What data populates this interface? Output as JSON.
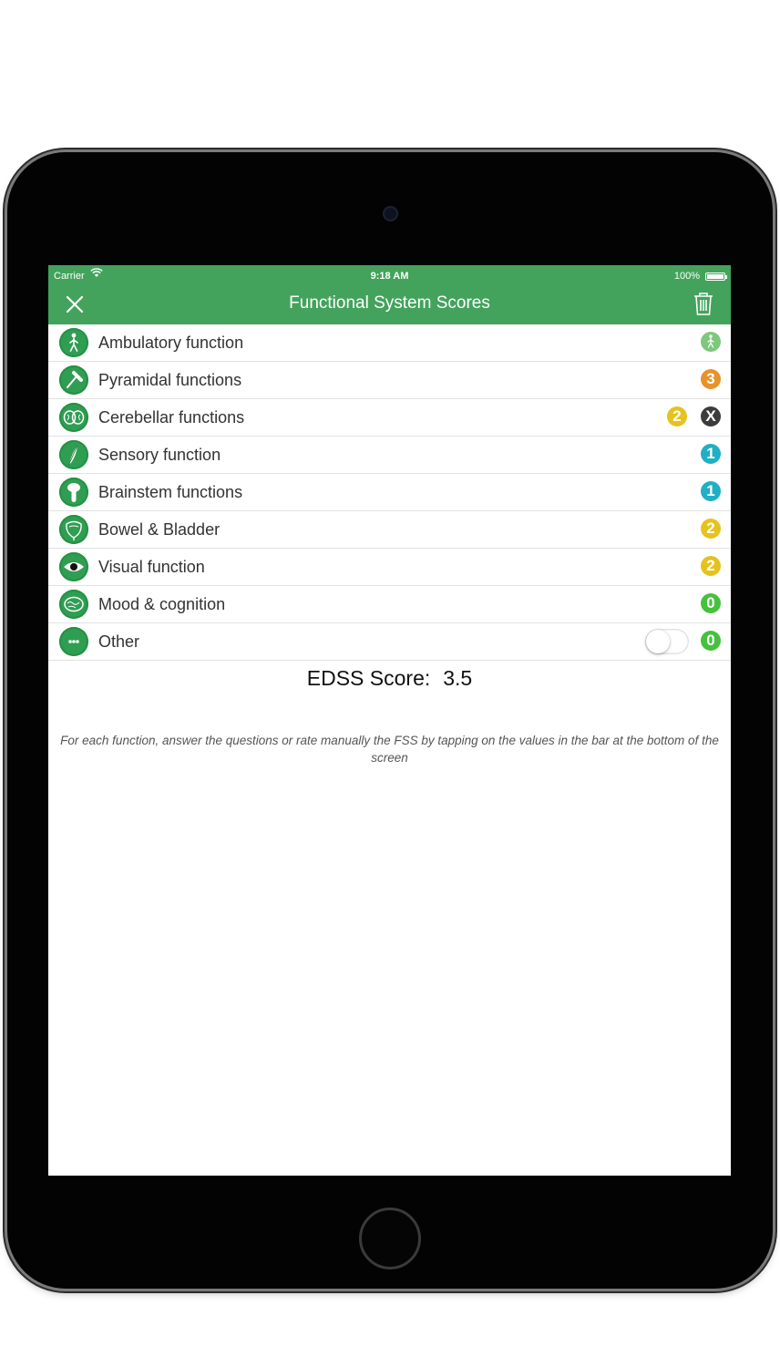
{
  "status_bar": {
    "carrier": "Carrier",
    "time": "9:18 AM",
    "battery": "100%"
  },
  "nav": {
    "title": "Functional System Scores",
    "close_icon": "close-icon",
    "trash_icon": "trash-icon"
  },
  "colors": {
    "header_green": "#43a35c",
    "row_icon_green": "#2f9e52",
    "score_orange": "#e8922a",
    "score_yellow": "#e6c21e",
    "score_cyan": "#21afc6",
    "score_green": "#46c13e",
    "score_dark": "#3c3c3c"
  },
  "rows": [
    {
      "label": "Ambulatory function",
      "icon": "walking-person-icon",
      "score_icon": "walking-person-icon"
    },
    {
      "label": "Pyramidal functions",
      "icon": "reflex-hammer-icon",
      "scores": [
        "3"
      ]
    },
    {
      "label": "Cerebellar functions",
      "icon": "cerebellum-icon",
      "scores": [
        "2",
        "X"
      ]
    },
    {
      "label": "Sensory function",
      "icon": "feather-icon",
      "scores": [
        "1"
      ]
    },
    {
      "label": "Brainstem functions",
      "icon": "brainstem-icon",
      "scores": [
        "1"
      ]
    },
    {
      "label": "Bowel & Bladder",
      "icon": "bladder-icon",
      "scores": [
        "2"
      ]
    },
    {
      "label": "Visual function",
      "icon": "eye-icon",
      "scores": [
        "2"
      ]
    },
    {
      "label": "Mood & cognition",
      "icon": "brain-icon",
      "scores": [
        "0"
      ]
    },
    {
      "label": "Other",
      "icon": "dots-icon",
      "toggle": false,
      "scores": [
        "0"
      ]
    }
  ],
  "edss": {
    "label": "EDSS Score:",
    "value": "3.5"
  },
  "hint": "For each function, answer the questions or rate manually the FSS by tapping on the values in the bar at the bottom of the screen"
}
